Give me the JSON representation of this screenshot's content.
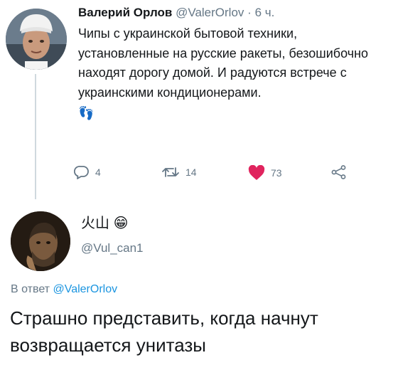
{
  "tweet": {
    "author_name": "Валерий Орлов",
    "author_handle": "@ValerOrlov",
    "separator": "·",
    "time": "6 ч.",
    "text": "Чипы с украинской бытовой техники, установленные на русские ракеты, безошибочно находят дорогу домой. И радуются встрече с украинскими кондиционерами.",
    "emoji": "👣",
    "actions": {
      "replies": "4",
      "retweets": "14",
      "likes": "73"
    }
  },
  "reply": {
    "author_name": "火山",
    "author_name_emoji": "😁",
    "author_handle": "@Vul_can1",
    "in_reply_prefix": "В ответ",
    "in_reply_handle": "@ValerOrlov",
    "text": "Страшно представить, когда начнут возвращается унитазы"
  },
  "colors": {
    "text": "#14171a",
    "secondary": "#657786",
    "link": "#1b95e0",
    "like": "#e0245e",
    "thread_line": "#cfd9de"
  },
  "icons": {
    "reply": "reply-icon",
    "retweet": "retweet-icon",
    "like": "heart-icon",
    "share": "share-icon"
  }
}
